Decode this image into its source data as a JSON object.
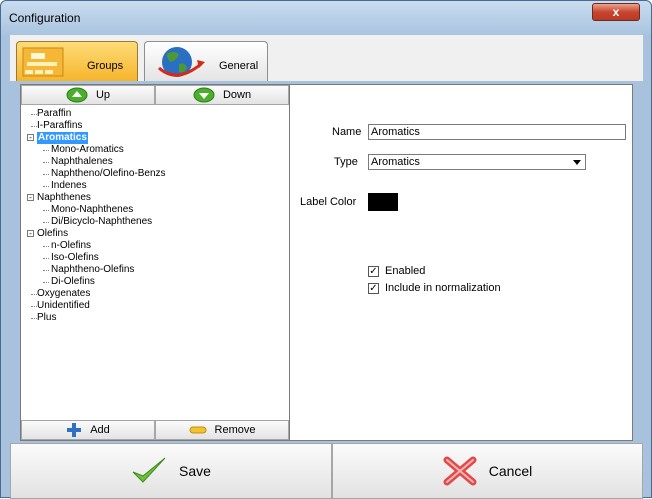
{
  "window": {
    "title": "Configuration",
    "close_glyph": "x"
  },
  "tabs": [
    {
      "label": "Groups",
      "icon": "groups-icon",
      "selected": true
    },
    {
      "label": "General",
      "icon": "globe-icon",
      "selected": false
    }
  ],
  "tree_toolbar": {
    "up_label": "Up",
    "down_label": "Down"
  },
  "tree": [
    {
      "label": "Paraffin"
    },
    {
      "label": "I-Paraffins"
    },
    {
      "label": "Aromatics"
    },
    {
      "label": "Mono-Aromatics"
    },
    {
      "label": "Naphthalenes"
    },
    {
      "label": "Naphtheno/Olefino-Benzs"
    },
    {
      "label": "Indenes"
    },
    {
      "label": "Naphthenes"
    },
    {
      "label": "Mono-Naphthenes"
    },
    {
      "label": "Di/Bicyclo-Naphthenes"
    },
    {
      "label": "Olefins"
    },
    {
      "label": "n-Olefins"
    },
    {
      "label": "Iso-Olefins"
    },
    {
      "label": "Naphtheno-Olefins"
    },
    {
      "label": "Di-Olefins"
    },
    {
      "label": "Oxygenates"
    },
    {
      "label": "Unidentified"
    },
    {
      "label": "Plus"
    }
  ],
  "tree_actions": {
    "add_label": "Add",
    "remove_label": "Remove"
  },
  "form": {
    "name_label": "Name",
    "name_value": "Aromatics",
    "type_label": "Type",
    "type_value": "Aromatics",
    "label_color_label": "Label Color",
    "label_color_value": "#000000",
    "enabled_label": "Enabled",
    "enabled_checked": true,
    "normalization_label": "Include in normalization",
    "normalization_checked": true
  },
  "actions": {
    "save_label": "Save",
    "cancel_label": "Cancel"
  },
  "colors": {
    "selection": "#3399ff",
    "panel_bg": "#a8c2de",
    "groups_tab": "#f7b52c"
  }
}
